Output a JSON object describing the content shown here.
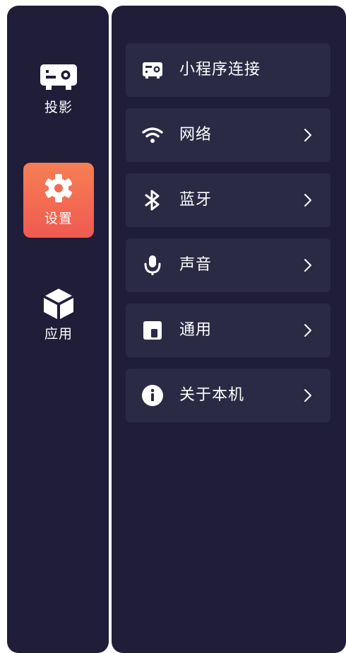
{
  "sidebar": {
    "items": [
      {
        "label": "投影",
        "icon": "projector-icon",
        "active": false
      },
      {
        "label": "设置",
        "icon": "gear-icon",
        "active": true
      },
      {
        "label": "应用",
        "icon": "cube-icon",
        "active": false
      }
    ]
  },
  "settings": {
    "items": [
      {
        "label": "小程序连接",
        "icon": "mini-program-icon",
        "has_chevron": false
      },
      {
        "label": "网络",
        "icon": "wifi-icon",
        "has_chevron": true
      },
      {
        "label": "蓝牙",
        "icon": "bluetooth-icon",
        "has_chevron": true
      },
      {
        "label": "声音",
        "icon": "microphone-icon",
        "has_chevron": true
      },
      {
        "label": "通用",
        "icon": "general-icon",
        "has_chevron": true
      },
      {
        "label": "关于本机",
        "icon": "info-icon",
        "has_chevron": true
      }
    ]
  },
  "colors": {
    "panel_bg": "#1f1d38",
    "row_bg": "#2b2a45",
    "accent_top": "#f67f53",
    "accent_bottom": "#ef5a52",
    "text": "#ffffff"
  }
}
